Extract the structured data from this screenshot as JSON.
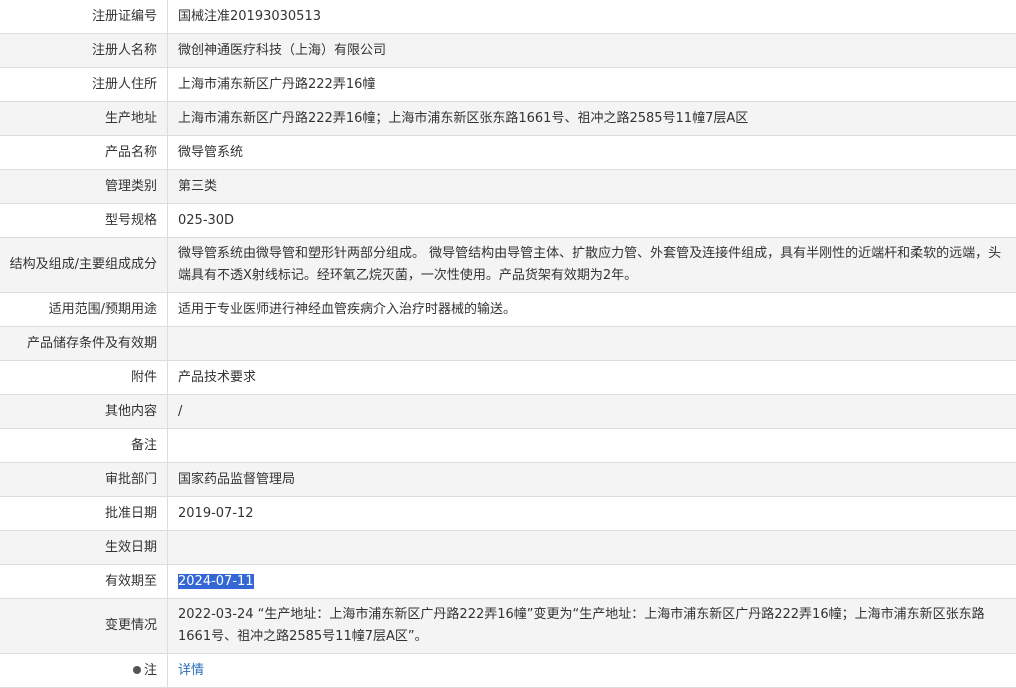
{
  "rows": [
    {
      "label": "注册证编号",
      "value": "国械注准20193030513"
    },
    {
      "label": "注册人名称",
      "value": "微创神通医疗科技（上海）有限公司"
    },
    {
      "label": "注册人住所",
      "value": "上海市浦东新区广丹路222弄16幢"
    },
    {
      "label": "生产地址",
      "value": "上海市浦东新区广丹路222弄16幢；上海市浦东新区张东路1661号、祖冲之路2585号11幢7层A区"
    },
    {
      "label": "产品名称",
      "value": "微导管系统"
    },
    {
      "label": "管理类别",
      "value": "第三类"
    },
    {
      "label": "型号规格",
      "value": "025-30D"
    },
    {
      "label": "结构及组成/主要组成成分",
      "value": "微导管系统由微导管和塑形针两部分组成。 微导管结构由导管主体、扩散应力管、外套管及连接件组成，具有半刚性的近端杆和柔软的远端，头端具有不透X射线标记。经环氧乙烷灭菌，一次性使用。产品货架有效期为2年。"
    },
    {
      "label": "适用范围/预期用途",
      "value": "适用于专业医师进行神经血管疾病介入治疗时器械的输送。"
    },
    {
      "label": "产品储存条件及有效期",
      "value": ""
    },
    {
      "label": "附件",
      "value": "产品技术要求"
    },
    {
      "label": "其他内容",
      "value": "/"
    },
    {
      "label": "备注",
      "value": ""
    },
    {
      "label": "审批部门",
      "value": "国家药品监督管理局"
    },
    {
      "label": "批准日期",
      "value": "2019-07-12"
    },
    {
      "label": "生效日期",
      "value": ""
    },
    {
      "label": "有效期至",
      "value": "2024-07-11"
    },
    {
      "label": "变更情况",
      "value": "2022-03-24 “生产地址：上海市浦东新区广丹路222弄16幢”变更为“生产地址：上海市浦东新区广丹路222弄16幢；上海市浦东新区张东路1661号、祖冲之路2585号11幢7层A区”。"
    },
    {
      "label": "注",
      "value": "详情"
    }
  ]
}
